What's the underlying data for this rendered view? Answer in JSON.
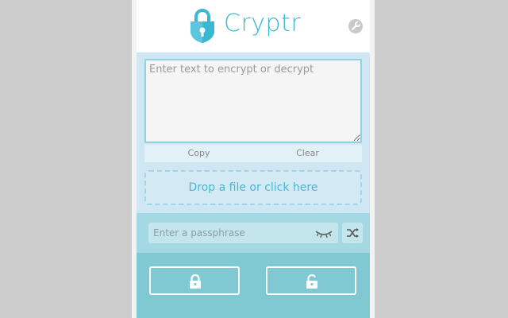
{
  "app": {
    "title": "Cryptr"
  },
  "icons": {
    "logo": "padlock-shield-logo",
    "settings": "wrench-icon",
    "eye": "closed-eye-icon",
    "shuffle": "shuffle-icon",
    "encrypt": "locked-padlock-icon",
    "decrypt": "unlocked-padlock-icon"
  },
  "text": {
    "placeholder": "Enter text to encrypt or decrypt",
    "copy_label": "Copy",
    "clear_label": "Clear"
  },
  "dropzone": {
    "label": "Drop a file or click here"
  },
  "passphrase": {
    "placeholder": "Enter a passphrase"
  },
  "colors": {
    "brand": "#3ab8d2",
    "text_bg": "#cfe7f2",
    "pass_bg": "#a4d8e2",
    "action_bg": "#80c9d3"
  }
}
